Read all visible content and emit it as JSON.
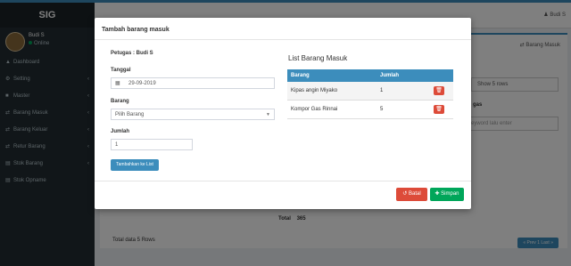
{
  "sidebar": {
    "brand": "SIG",
    "user_name": "Budi S",
    "user_status": "Online",
    "items": [
      {
        "icon": "dashboard-icon",
        "glyph": "▲",
        "label": "Dashboard"
      },
      {
        "icon": "settings-icon",
        "glyph": "⚙",
        "label": "Setting"
      },
      {
        "icon": "folder-icon",
        "glyph": "■",
        "label": "Master"
      },
      {
        "icon": "exchange-icon",
        "glyph": "⇄",
        "label": "Barang Masuk"
      },
      {
        "icon": "exchange-icon",
        "glyph": "⇄",
        "label": "Barang Keluar"
      },
      {
        "icon": "exchange-icon",
        "glyph": "⇄",
        "label": "Retur Barang"
      },
      {
        "icon": "file-icon",
        "glyph": "▤",
        "label": "Stok Barang"
      },
      {
        "icon": "file-icon",
        "glyph": "▤",
        "label": "Stok Opname"
      }
    ]
  },
  "header": {
    "user_label": "Budi S"
  },
  "background": {
    "breadcrumb": "Barang Masuk",
    "show_rows": "Show 5 rows",
    "search_label": "gas",
    "search_placeholder": "ik keyword lalu enter",
    "total_label": "Total",
    "total_value": "365",
    "total_data": "Total data 5 Rows",
    "pager": "« Prev   1   Last »"
  },
  "modal": {
    "title": "Tambah barang masuk",
    "petugas": "Petugas : Budi S",
    "tanggal_label": "Tanggal",
    "tanggal_value": "29-09-2019",
    "barang_label": "Barang",
    "barang_placeholder": "Pilih Barang",
    "jumlah_label": "Jumlah",
    "jumlah_value": "1",
    "add_button": "Tambahkan ke List",
    "list_title": "List Barang Masuk",
    "list_headers": [
      "Barang",
      "Jumlah",
      ""
    ],
    "list_rows": [
      {
        "barang": "Kipas angin Miyako",
        "jumlah": "1"
      },
      {
        "barang": "Kompor Gas Rinnai",
        "jumlah": "5"
      }
    ],
    "batal_button": "Batal",
    "simpan_button": "Simpan"
  },
  "colors": {
    "primary": "#3c8dbc",
    "danger": "#dd4b39",
    "success": "#00a65a",
    "sidebar": "#222d32"
  }
}
